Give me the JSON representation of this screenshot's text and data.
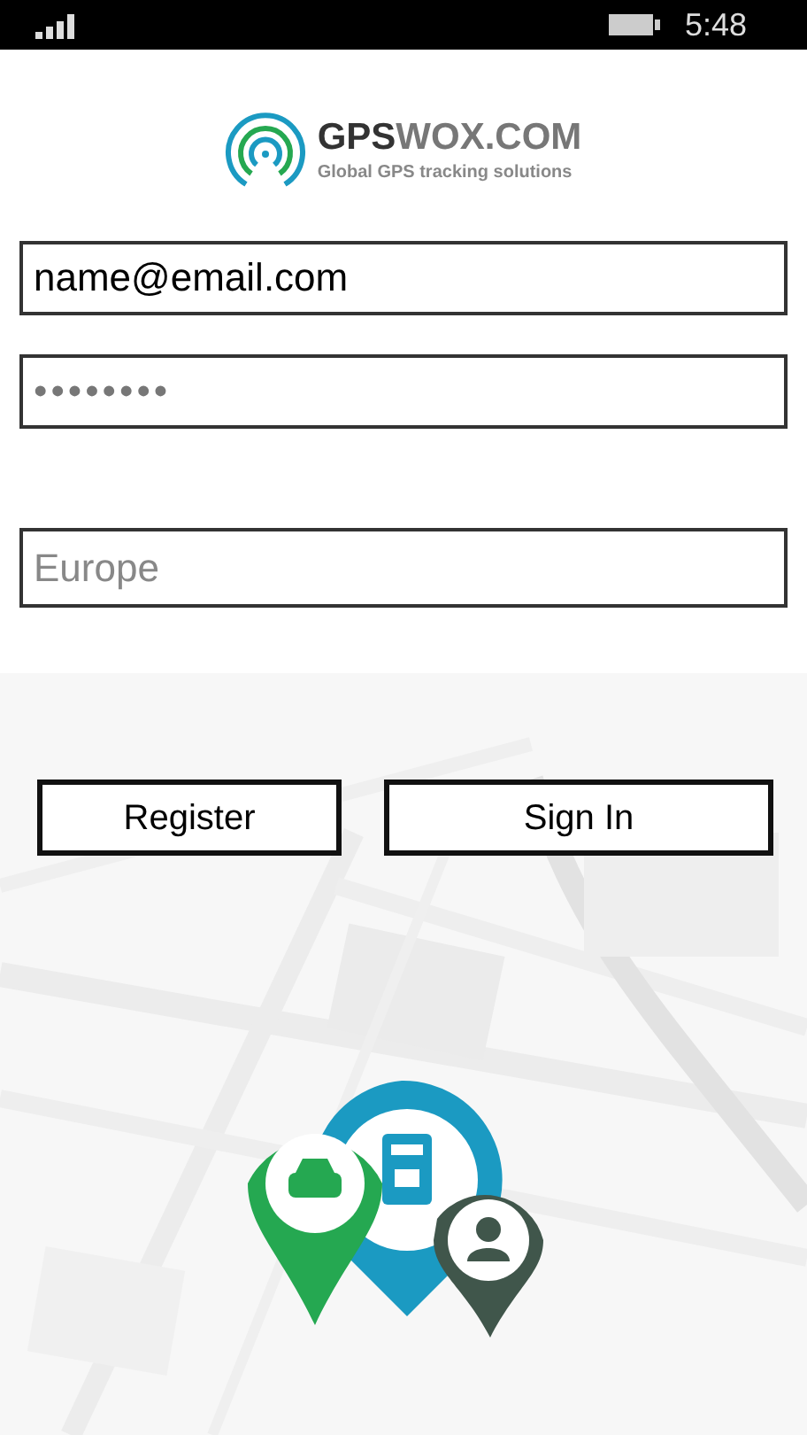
{
  "status_bar": {
    "time": "5:48"
  },
  "logo": {
    "name_bold": "GPS",
    "name_rest": "WOX.COM",
    "tagline": "Global GPS tracking solutions"
  },
  "email_field": {
    "value": "name@email.com"
  },
  "password_field": {
    "value": "••••••••"
  },
  "server_field": {
    "placeholder": "Europe"
  },
  "buttons": [
    {
      "label": "Register"
    },
    {
      "label": "Sign In"
    }
  ]
}
